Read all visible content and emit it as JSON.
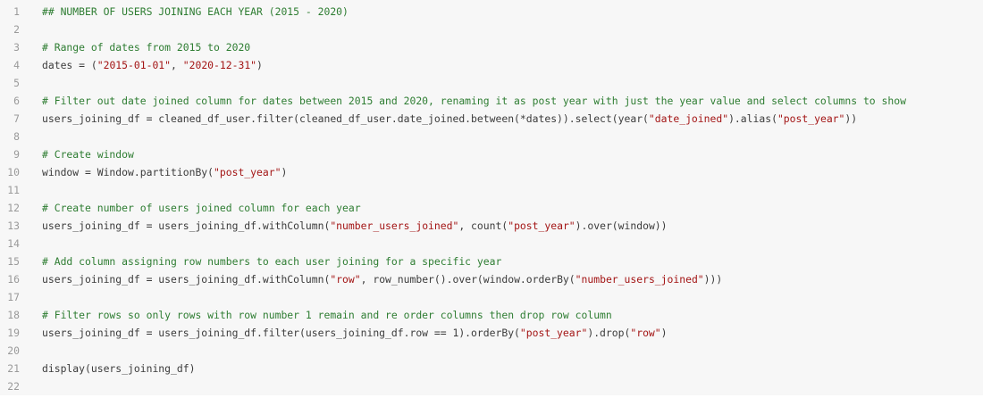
{
  "editor": {
    "lines": [
      {
        "n": "1",
        "tokens": [
          {
            "t": "c",
            "v": "## NUMBER OF USERS JOINING EACH YEAR (2015 - 2020)"
          }
        ]
      },
      {
        "n": "2",
        "tokens": []
      },
      {
        "n": "3",
        "tokens": [
          {
            "t": "c",
            "v": "# Range of dates from 2015 to 2020"
          }
        ]
      },
      {
        "n": "4",
        "tokens": [
          {
            "t": "p",
            "v": "dates = ("
          },
          {
            "t": "s",
            "v": "\"2015-01-01\""
          },
          {
            "t": "p",
            "v": ", "
          },
          {
            "t": "s",
            "v": "\"2020-12-31\""
          },
          {
            "t": "p",
            "v": ")"
          }
        ]
      },
      {
        "n": "5",
        "tokens": []
      },
      {
        "n": "6",
        "tokens": [
          {
            "t": "c",
            "v": "# Filter out date joined column for dates between 2015 and 2020, renaming it as post year with just the year value and select columns to show"
          }
        ]
      },
      {
        "n": "7",
        "tokens": [
          {
            "t": "p",
            "v": "users_joining_df = cleaned_df_user.filter(cleaned_df_user.date_joined.between(*dates)).select(year("
          },
          {
            "t": "s",
            "v": "\"date_joined\""
          },
          {
            "t": "p",
            "v": ").alias("
          },
          {
            "t": "s",
            "v": "\"post_year\""
          },
          {
            "t": "p",
            "v": "))"
          }
        ]
      },
      {
        "n": "8",
        "tokens": []
      },
      {
        "n": "9",
        "tokens": [
          {
            "t": "c",
            "v": "# Create window"
          }
        ]
      },
      {
        "n": "10",
        "tokens": [
          {
            "t": "p",
            "v": "window = Window.partitionBy("
          },
          {
            "t": "s",
            "v": "\"post_year\""
          },
          {
            "t": "p",
            "v": ")"
          }
        ]
      },
      {
        "n": "11",
        "tokens": []
      },
      {
        "n": "12",
        "tokens": [
          {
            "t": "c",
            "v": "# Create number of users joined column for each year"
          }
        ]
      },
      {
        "n": "13",
        "tokens": [
          {
            "t": "p",
            "v": "users_joining_df = users_joining_df.withColumn("
          },
          {
            "t": "s",
            "v": "\"number_users_joined\""
          },
          {
            "t": "p",
            "v": ", count("
          },
          {
            "t": "s",
            "v": "\"post_year\""
          },
          {
            "t": "p",
            "v": ").over(window))"
          }
        ]
      },
      {
        "n": "14",
        "tokens": []
      },
      {
        "n": "15",
        "tokens": [
          {
            "t": "c",
            "v": "# Add column assigning row numbers to each user joining for a specific year"
          }
        ]
      },
      {
        "n": "16",
        "tokens": [
          {
            "t": "p",
            "v": "users_joining_df = users_joining_df.withColumn("
          },
          {
            "t": "s",
            "v": "\"row\""
          },
          {
            "t": "p",
            "v": ", row_number().over(window.orderBy("
          },
          {
            "t": "s",
            "v": "\"number_users_joined\""
          },
          {
            "t": "p",
            "v": ")))"
          }
        ]
      },
      {
        "n": "17",
        "tokens": []
      },
      {
        "n": "18",
        "tokens": [
          {
            "t": "c",
            "v": "# Filter rows so only rows with row number 1 remain and re order columns then drop row column"
          }
        ]
      },
      {
        "n": "19",
        "tokens": [
          {
            "t": "p",
            "v": "users_joining_df = users_joining_df.filter(users_joining_df.row == 1).orderBy("
          },
          {
            "t": "s",
            "v": "\"post_year\""
          },
          {
            "t": "p",
            "v": ").drop("
          },
          {
            "t": "s",
            "v": "\"row\""
          },
          {
            "t": "p",
            "v": ")"
          }
        ]
      },
      {
        "n": "20",
        "tokens": []
      },
      {
        "n": "21",
        "tokens": [
          {
            "t": "p",
            "v": "display(users_joining_df)"
          }
        ]
      },
      {
        "n": "22",
        "tokens": []
      }
    ]
  },
  "colors": {
    "background": "#f7f7f7",
    "comment": "#2e7d32",
    "string": "#a31515",
    "text": "#3b3b3b",
    "line_number": "#9a9a9a"
  }
}
